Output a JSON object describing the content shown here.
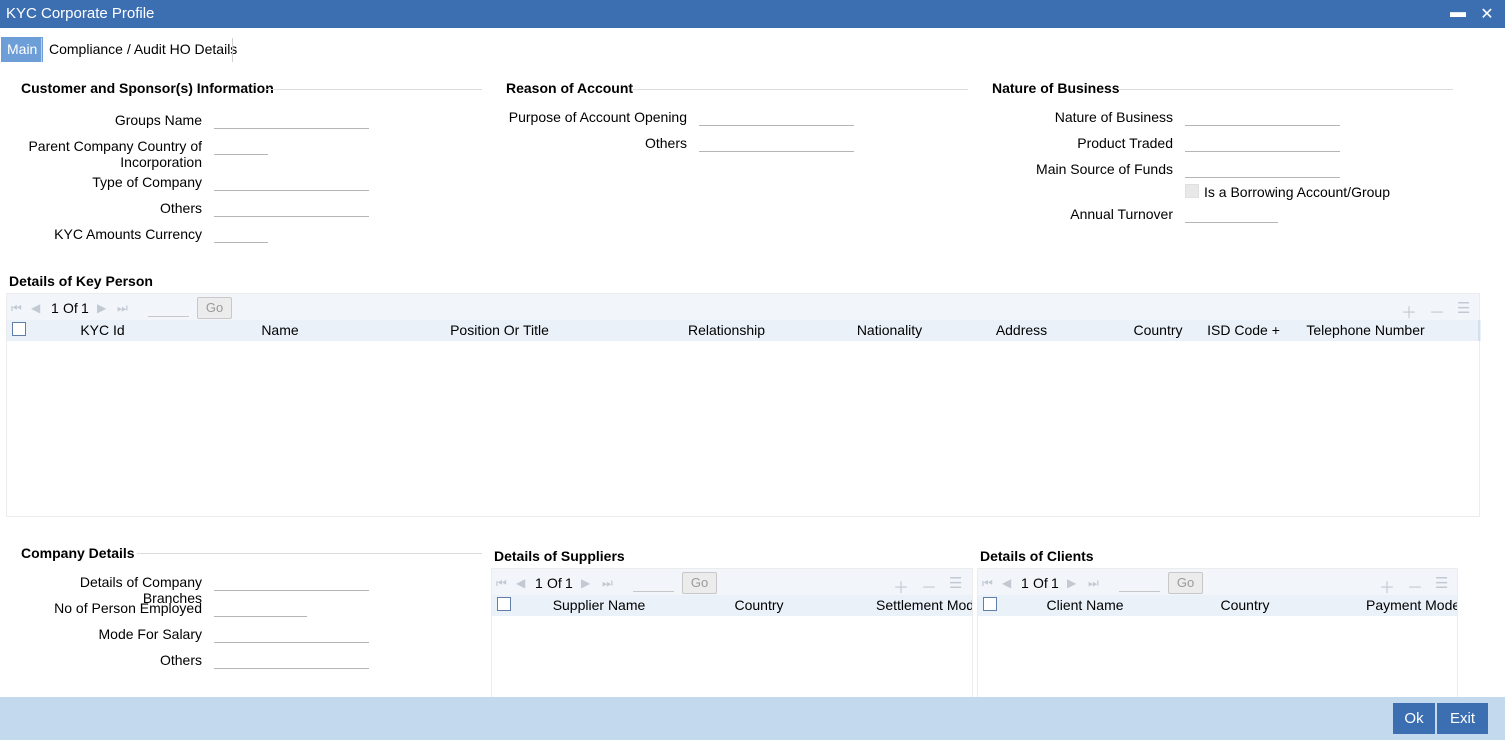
{
  "window": {
    "title": "KYC Corporate Profile",
    "minimize": "▬",
    "close": "✕"
  },
  "tabs": [
    "Main",
    "Compliance / Audit HO Details"
  ],
  "customer": {
    "title": "Customer and Sponsor(s) Information",
    "groups_name": "Groups Name",
    "parent_country": "Parent Company Country of Incorporation",
    "type_of_company": "Type of Company",
    "others": "Others",
    "kyc_currency": "KYC Amounts Currency"
  },
  "reason": {
    "title": "Reason of Account",
    "purpose": "Purpose of Account Opening",
    "others": "Others"
  },
  "nature": {
    "title": "Nature of Business",
    "nature_of_business": "Nature of Business",
    "product_traded": "Product Traded",
    "main_source": "Main Source of Funds",
    "borrowing": "Is a Borrowing Account/Group",
    "annual_turnover": "Annual Turnover"
  },
  "key_person": {
    "title": "Details of Key Person",
    "page_current": "1",
    "page_of": "Of",
    "page_total": "1",
    "go": "Go",
    "columns": [
      "KYC Id",
      "Name",
      "Position Or Title",
      "Relationship",
      "Nationality",
      "Address",
      "Country",
      "ISD Code +",
      "Telephone Number"
    ]
  },
  "company": {
    "title": "Company Details",
    "branches": "Details of Company Branches",
    "persons": "No of Person Employed",
    "salary_mode": "Mode For Salary",
    "others": "Others"
  },
  "suppliers": {
    "title": "Details of Suppliers",
    "page_current": "1",
    "page_of": "Of",
    "page_total": "1",
    "go": "Go",
    "columns": [
      "Supplier Name",
      "Country",
      "Settlement Mode"
    ]
  },
  "clients": {
    "title": "Details of Clients",
    "page_current": "1",
    "page_of": "Of",
    "page_total": "1",
    "go": "Go",
    "columns": [
      "Client Name",
      "Country",
      "Payment Mode"
    ]
  },
  "footer": {
    "ok": "Ok",
    "exit": "Exit"
  }
}
